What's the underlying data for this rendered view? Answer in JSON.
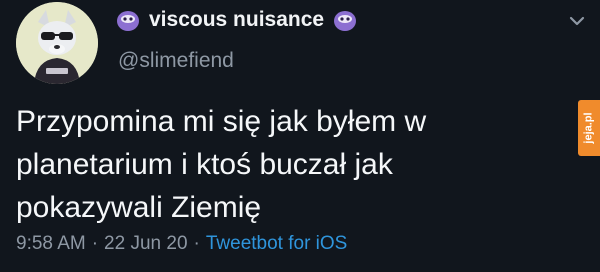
{
  "user": {
    "display_name": "viscous nuisance",
    "handle": "@slimefiend",
    "name_emoji": "purple-slime-emoji"
  },
  "tweet": {
    "text": "Przypomina mi się jak byłem w\nplanetarium i ktoś buczał jak\npokazywali Ziemię",
    "time": "9:58 AM",
    "separator": "·",
    "date": "22 Jun 20",
    "client": "Tweetbot for iOS"
  },
  "watermark": {
    "text": "jeja.pl"
  },
  "colors": {
    "background": "#11161d",
    "muted_text": "#8e98a4",
    "link": "#2f95dc",
    "emoji": "#8c6fd1",
    "watermark": "#f08b2c"
  }
}
